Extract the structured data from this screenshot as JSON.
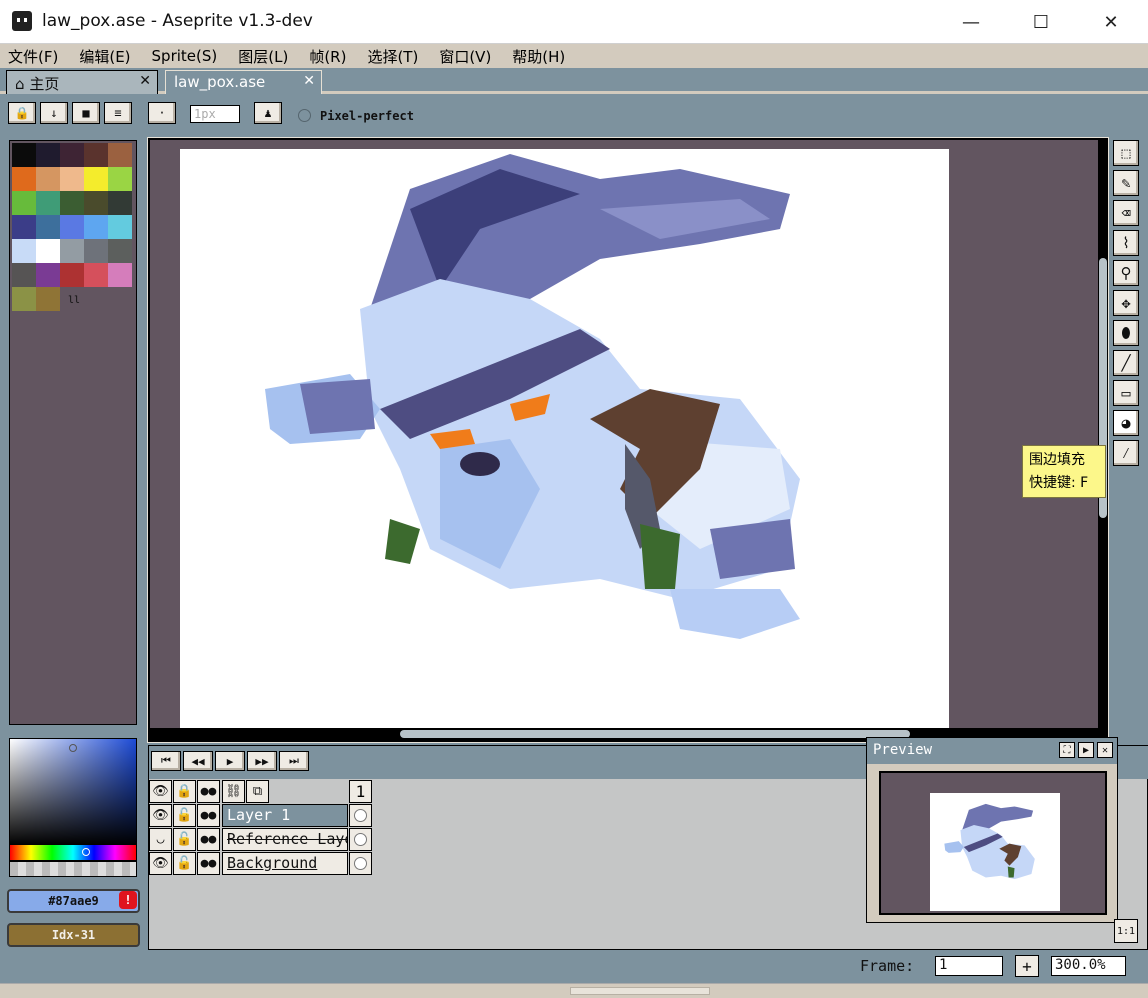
{
  "window": {
    "title": "law_pox.ase - Aseprite v1.3-dev",
    "minimize": "—",
    "maximize": "☐",
    "close": "✕"
  },
  "menu": [
    "文件(F)",
    "编辑(E)",
    "Sprite(S)",
    "图层(L)",
    "帧(R)",
    "选择(T)",
    "窗口(V)",
    "帮助(H)"
  ],
  "tabs": {
    "home": "主页",
    "file": "law_pox.ase",
    "close": "✕"
  },
  "context": {
    "brush_size_placeholder": "1px",
    "pixel_perfect": "Pixel-perfect"
  },
  "palette": {
    "colors": [
      "#0b0b0b",
      "#1f1b2e",
      "#3e2434",
      "#5a332d",
      "#9b6140",
      "#df6a1c",
      "#d59661",
      "#efb98c",
      "#f4ec2c",
      "#9ad544",
      "#67bb3b",
      "#3f9c77",
      "#3b5d32",
      "#4a4b2c",
      "#323a35",
      "#3b3d88",
      "#3d6f9c",
      "#5a79e3",
      "#5ea6f0",
      "#63cbdf",
      "#c8dbf7",
      "#ffffff",
      "#939ca3",
      "#6e727a",
      "#5c5f5d",
      "#565454",
      "#7a3b94",
      "#ad3232",
      "#d5505c",
      "#d57dbb",
      "#8b9246",
      "#8f7436"
    ],
    "more": "ll"
  },
  "color_picker": {
    "hex": "#87aae9",
    "warning": "!",
    "index": "Idx-31"
  },
  "tools": [
    "⬚",
    "✎",
    "⌫",
    "⌇",
    "⚲",
    "✥",
    "⬮",
    "╱",
    "▭",
    "◕",
    "⁄"
  ],
  "tooltip": {
    "line1": "围边填充",
    "line2": "快捷键: F"
  },
  "timeline": {
    "anim_buttons": [
      "⏮",
      "◀◀",
      "▶",
      "▶▶",
      "⏭"
    ],
    "header_icons": [
      "👁",
      "🔒",
      "●●",
      "⛓",
      "⧉"
    ],
    "frame_header": "1",
    "layers": [
      {
        "eye": "👁",
        "lock": "🔓",
        "cont": "●●",
        "name": "Layer 1"
      },
      {
        "eye": "◡",
        "lock": "🔓",
        "cont": "●●",
        "name": "Reference Layer"
      },
      {
        "eye": "👁",
        "lock": "🔓",
        "cont": "●●",
        "name": "Background"
      }
    ]
  },
  "preview": {
    "title": "Preview",
    "btn_center": "⛶",
    "btn_play": "▶",
    "btn_close": "✕",
    "one_to_one": "1:1"
  },
  "status": {
    "frame_label": "Frame:",
    "frame_value": "1",
    "add": "+",
    "zoom": "300.0%"
  }
}
